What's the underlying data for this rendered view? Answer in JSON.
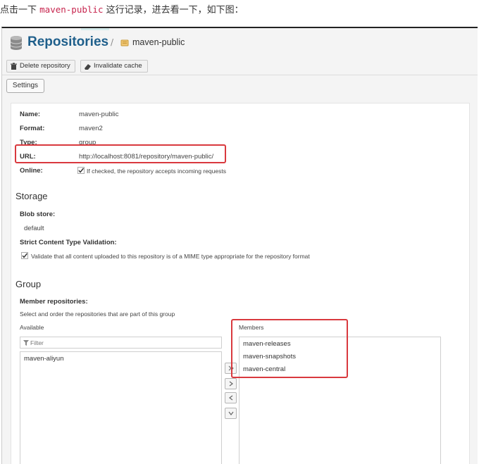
{
  "caption": {
    "before": "点击一下",
    "code": "maven-public",
    "after": "这行记录，进去看一下，如下图："
  },
  "header": {
    "title": "Repositories",
    "separator": "/",
    "repo_name": "maven-public",
    "icon": "database-icon"
  },
  "toolbar": {
    "delete_label": "Delete repository",
    "invalidate_label": "Invalidate cache"
  },
  "tabs": {
    "settings_label": "Settings"
  },
  "details": {
    "name_label": "Name:",
    "name_value": "maven-public",
    "format_label": "Format:",
    "format_value": "maven2",
    "type_label": "Type:",
    "type_value": "group",
    "url_label": "URL:",
    "url_value": "http://localhost:8081/repository/maven-public/",
    "online_label": "Online:",
    "online_text": "If checked, the repository accepts incoming requests",
    "online_checked": true
  },
  "storage": {
    "heading": "Storage",
    "blob_label": "Blob store:",
    "blob_value": "default",
    "strict_label": "Strict Content Type Validation:",
    "strict_text": "Validate that all content uploaded to this repository is of a MIME type appropriate for the repository format",
    "strict_checked": true
  },
  "group": {
    "heading": "Group",
    "members_label": "Member repositories:",
    "members_help": "Select and order the repositories that are part of this group",
    "available_label": "Available",
    "members_col_label": "Members",
    "filter_placeholder": "Filter",
    "available": [
      "maven-aliyun"
    ],
    "members": [
      "maven-releases",
      "maven-snapshots",
      "maven-central"
    ]
  },
  "colors": {
    "title": "#1f5f8b",
    "highlight": "#d9393e"
  }
}
